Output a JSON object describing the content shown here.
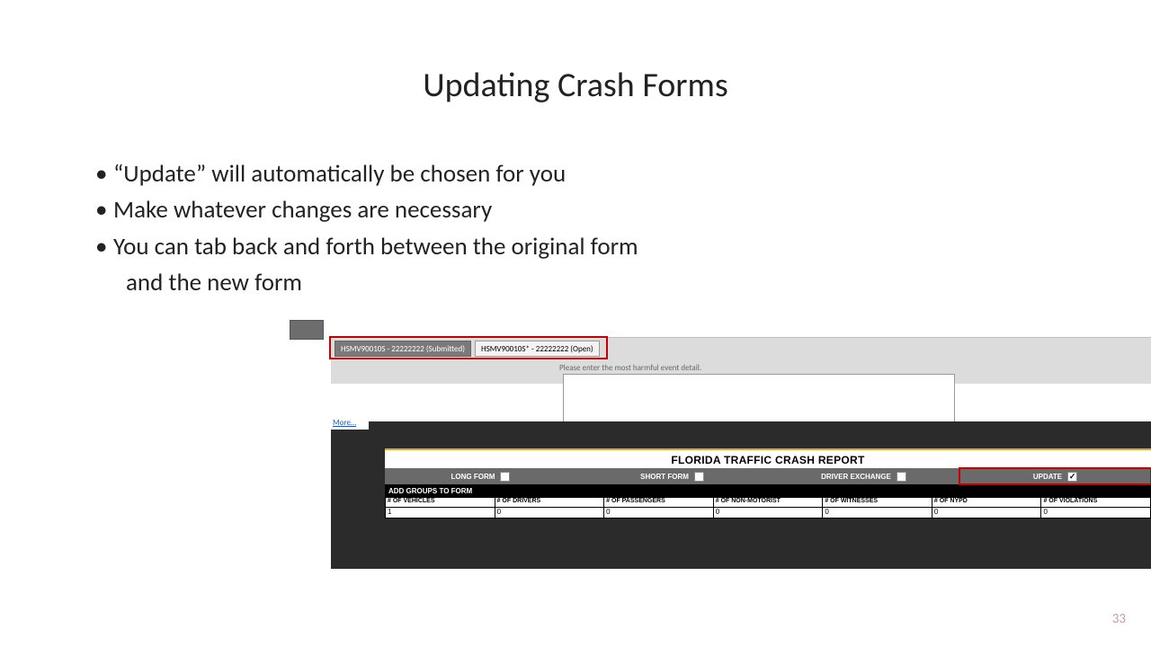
{
  "title": "Updating Crash Forms",
  "bullets": {
    "b1": "“Update” will automatically be chosen for you",
    "b2": "Make whatever changes are necessary",
    "b3": "You can tab back and forth between the original form",
    "b3b": "and the new form"
  },
  "tabs": {
    "t1": "HSMV90010S - 22222222 (Submitted)",
    "t2": "HSMV90010S* - 22222222 (Open)"
  },
  "prompt_text": "Please enter the most harmful event detail.",
  "more_link": "More…",
  "report": {
    "title": "FLORIDA TRAFFIC CRASH REPORT",
    "types": {
      "long": "LONG FORM",
      "short": "SHORT FORM",
      "drvex": "DRIVER EXCHANGE",
      "update": "UPDATE"
    },
    "update_checked": "✓",
    "addrow": "ADD GROUPS TO FORM",
    "cols": {
      "c1": "# OF VEHICLES",
      "c2": "# OF DRIVERS",
      "c3": "# OF PASSENGERS",
      "c4": "# OF NON-MOTORIST",
      "c5": "# OF WITNESSES",
      "c6": "# OF NYPD",
      "c7": "# OF VIOLATIONS"
    },
    "vals": {
      "v1": "1",
      "v2": "0",
      "v3": "0",
      "v4": "0",
      "v5": "0",
      "v6": "0",
      "v7": "0"
    }
  },
  "page_number": "33"
}
